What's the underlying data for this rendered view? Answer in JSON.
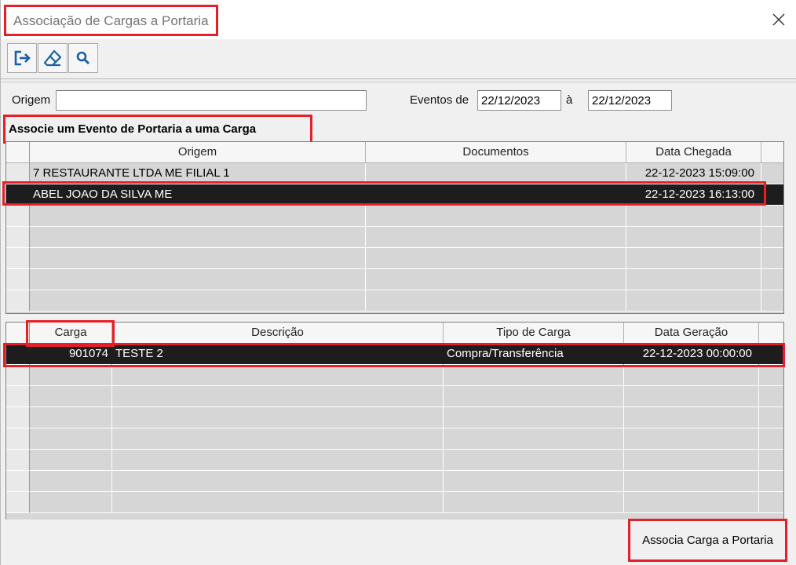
{
  "window": {
    "title": "Associação de Cargas a Portaria"
  },
  "toolbar": {
    "buttons": [
      {
        "icon": "exit-icon"
      },
      {
        "icon": "eraser-icon"
      },
      {
        "icon": "search-icon"
      }
    ]
  },
  "filters": {
    "origem_label": "Origem",
    "origem_value": "",
    "eventos_label": "Eventos de",
    "date_from": "22/12/2023",
    "between_label": "à",
    "date_to": "22/12/2023"
  },
  "section_title": "Associe um Evento de Portaria a uma Carga",
  "events_grid": {
    "columns": [
      "Origem",
      "Documentos",
      "Data Chegada"
    ],
    "rows": [
      {
        "origem": "7 RESTAURANTE LTDA ME FILIAL 1",
        "documentos": "",
        "data_chegada": "22-12-2023 15:09:00"
      },
      {
        "origem": "ABEL JOAO DA SILVA ME",
        "documentos": "",
        "data_chegada": "22-12-2023 16:13:00"
      }
    ],
    "selected_row": 1
  },
  "cargas_grid": {
    "columns": [
      "Carga",
      "Descrição",
      "Tipo de Carga",
      "Data Geração"
    ],
    "rows": [
      {
        "carga": "901074",
        "descricao": "TESTE 2",
        "tipo": "Compra/Transferência",
        "data_geracao": "22-12-2023 00:00:00"
      }
    ],
    "selected_row": 0
  },
  "actions": {
    "associate_label": "Associa Carga a Portaria"
  },
  "colors": {
    "highlight": "#e32027",
    "selection": "#1d1d1d",
    "toolbar_icon": "#1a5fa8"
  }
}
